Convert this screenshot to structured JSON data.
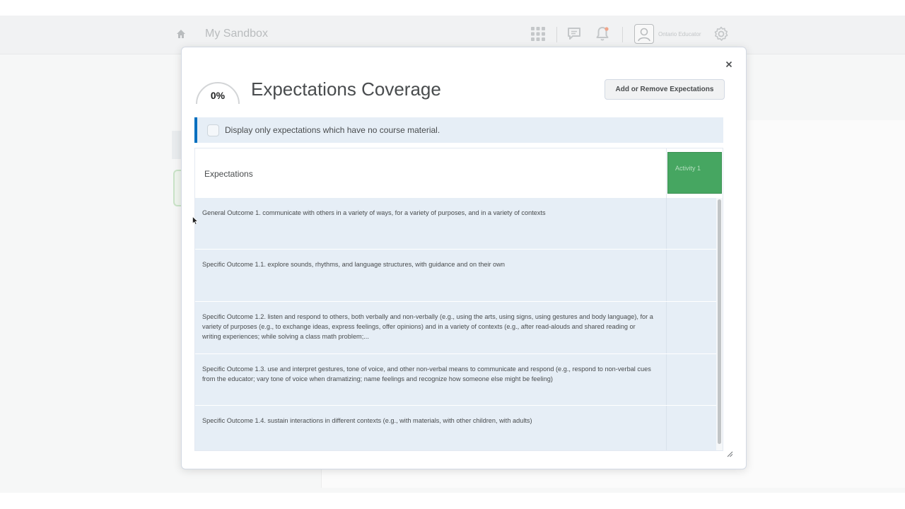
{
  "nav": {
    "title": "My Sandbox",
    "user_name": "Ontario Educator",
    "icons": [
      "home-icon",
      "apps-grid-icon",
      "chat-icon",
      "bell-icon",
      "avatar-icon",
      "gear-icon"
    ]
  },
  "modal": {
    "coverage_percent": "0%",
    "coverage_value": 0,
    "title": "Expectations Coverage",
    "add_button": "Add or Remove Expectations",
    "close_icon": "close-icon",
    "filter_label": "Display only expectations which have no course material.",
    "grid": {
      "header_label": "Expectations",
      "activity_label": "Activity 1",
      "rows": [
        "General Outcome 1. communicate with others in a variety of ways, for a variety of purposes, and in a variety of contexts",
        "Specific Outcome 1.1. explore sounds, rhythms, and language structures, with guidance and on their own",
        "Specific Outcome 1.2. listen and respond to others, both verbally and non-verbally (e.g., using the arts, using signs, using gestures and body language), for a variety of purposes (e.g., to exchange ideas, express feelings, offer opinions) and in a variety of contexts (e.g., after read-alouds and shared reading or writing experiences; while solving a class math problem;...",
        "Specific Outcome 1.3. use and interpret gestures, tone of voice, and other non-verbal means to communicate and respond (e.g., respond to non-verbal cues from the educator; vary tone of voice when dramatizing; name feelings and recognize how someone else might be feeling)",
        "Specific Outcome 1.4. sustain interactions in different contexts (e.g., with materials, with other children, with adults)"
      ]
    }
  },
  "colors": {
    "accent_blue": "#006fbf",
    "row_bg": "#e6eef6",
    "activity_green": "#46a661"
  }
}
